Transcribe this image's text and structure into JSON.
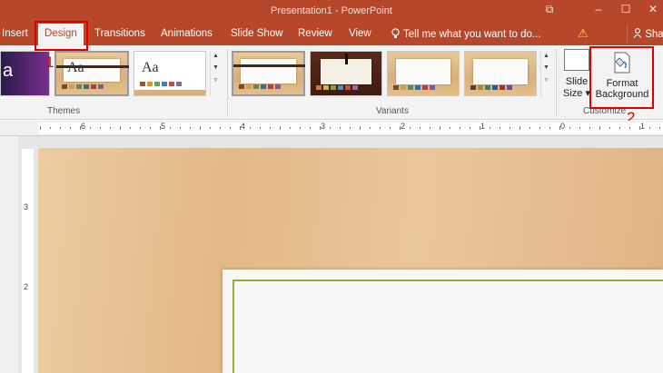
{
  "window": {
    "title": "Presentation1 - PowerPoint",
    "restore_glyph": "⧉",
    "minimize_glyph": "–",
    "maximize_glyph": "☐",
    "close_glyph": "✕"
  },
  "tabs": [
    {
      "label": "Insert"
    },
    {
      "label": "Design",
      "active": true
    },
    {
      "label": "Transitions"
    },
    {
      "label": "Animations"
    },
    {
      "label": "Slide Show"
    },
    {
      "label": "Review"
    },
    {
      "label": "View"
    }
  ],
  "tell_me": {
    "icon": "lightbulb-icon",
    "text": "Tell me what you want to do..."
  },
  "warning": {
    "icon": "warning-icon",
    "glyph": "⚠"
  },
  "share": {
    "icon": "person-icon",
    "label": "Sha"
  },
  "ribbon": {
    "themes_label": "Themes",
    "variants_label": "Variants",
    "customize_label": "Customize",
    "theme_first_glyph": "a",
    "theme_aa_1": "Aa",
    "theme_aa_2": "Aa",
    "slide_size_label_1": "Slide",
    "slide_size_label_2": "Size ▾",
    "format_bg_label_1": "Format",
    "format_bg_label_2": "Background",
    "scroll_up": "▲",
    "scroll_down": "▼",
    "more": "▿"
  },
  "annotations": {
    "step1": "1",
    "step2": "2"
  },
  "ruler": {
    "horizontal": [
      "6",
      "5",
      "4",
      "3",
      "2",
      "1",
      "0",
      "1"
    ],
    "vertical": [
      "3",
      "2"
    ]
  },
  "colors": {
    "accent": "#b7472a",
    "highlight": "#e00000",
    "slide_border": "#9aaa3a"
  }
}
